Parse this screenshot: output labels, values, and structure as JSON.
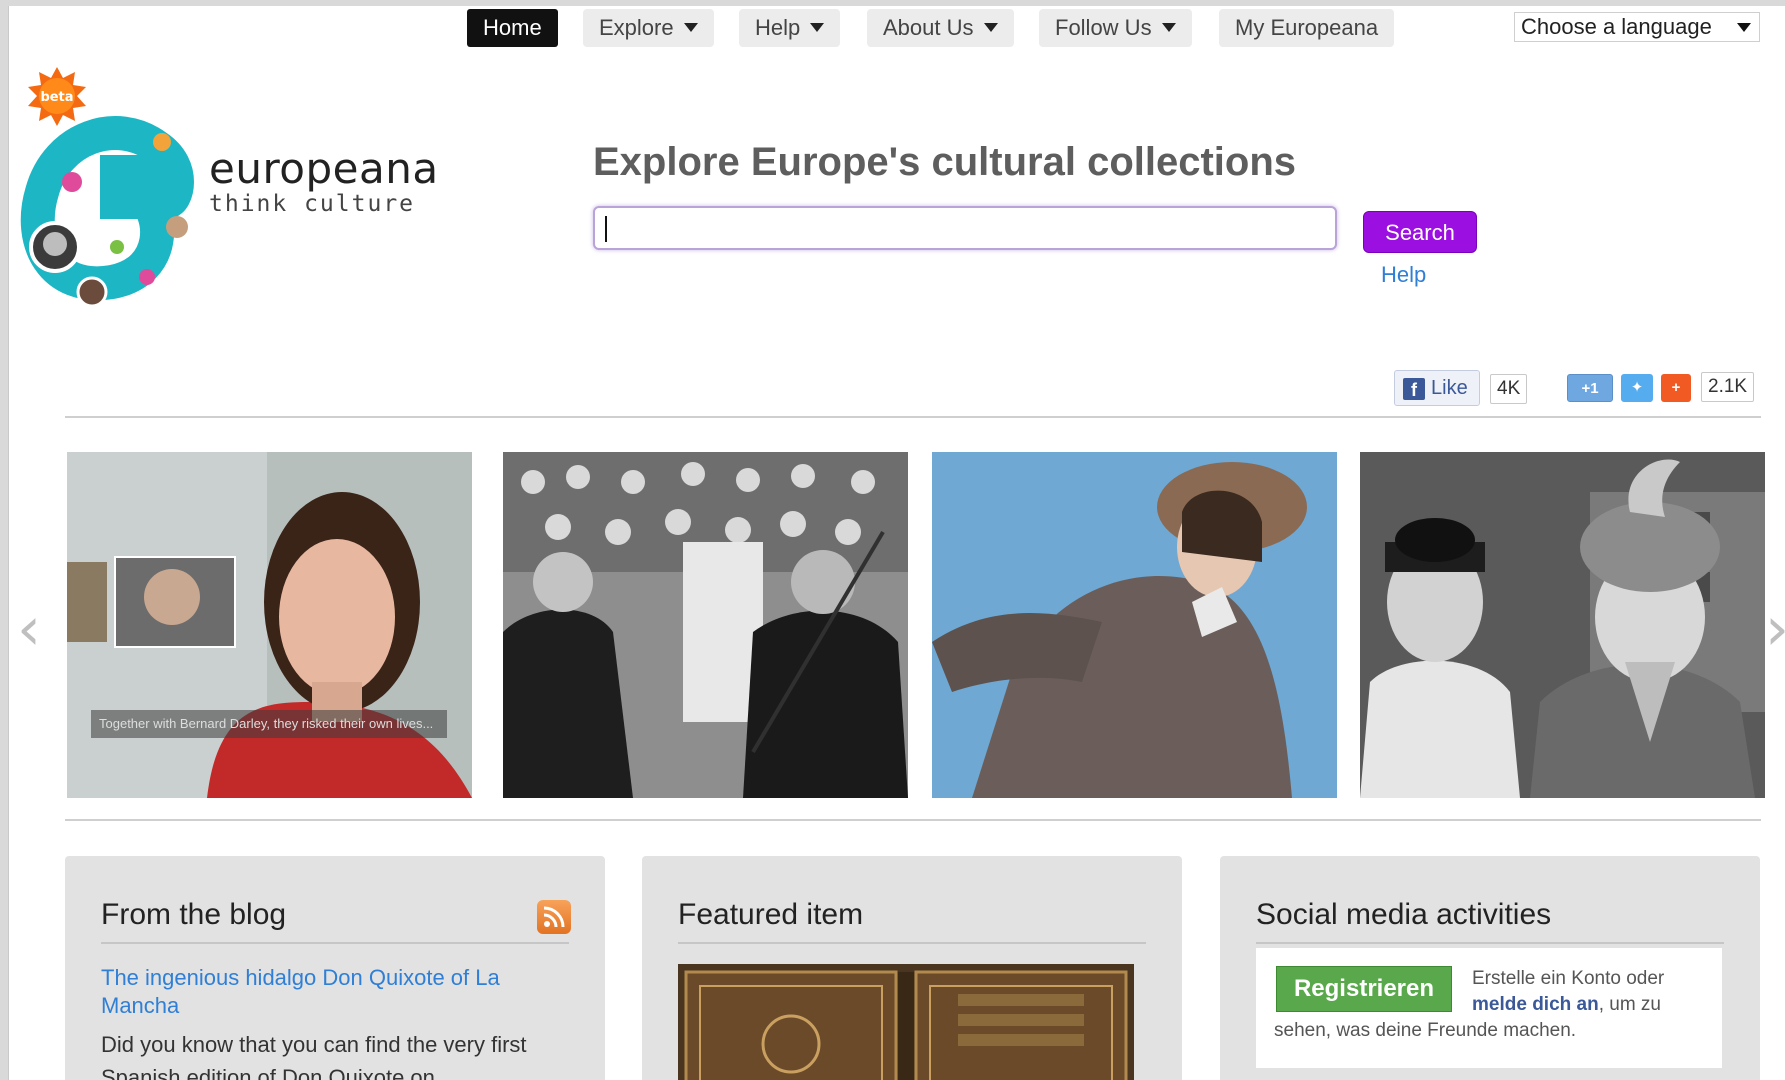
{
  "nav": {
    "home": "Home",
    "explore": "Explore",
    "help": "Help",
    "about": "About Us",
    "follow": "Follow Us",
    "my": "My Europeana",
    "language": "Choose a language"
  },
  "logo": {
    "name": "europeana",
    "tagline": "think culture",
    "badge": "beta"
  },
  "search": {
    "headline": "Explore Europe's cultural collections",
    "value": "",
    "button": "Search",
    "help": "Help"
  },
  "share": {
    "like": "Like",
    "like_count": "4K",
    "gplus": "+1",
    "share_count": "2.1K"
  },
  "carousel": {
    "caption": "Together with Bernard Darley, they risked their own lives..."
  },
  "blog": {
    "title": "From the blog",
    "link": "The ingenious hidalgo Don Quixote of La Mancha",
    "text": "Did you know that you can find the very first Spanish edition of Don Quixote on"
  },
  "featured": {
    "title": "Featured item"
  },
  "social": {
    "title": "Social media activities",
    "register": "Registrieren",
    "text_a": "Erstelle ein Konto oder",
    "link": "melde dich an",
    "text_b": ", um zu",
    "text_c": "sehen, was deine Freunde machen."
  },
  "colors": {
    "accent": "#9b10e0",
    "link": "#2f7fd6"
  }
}
